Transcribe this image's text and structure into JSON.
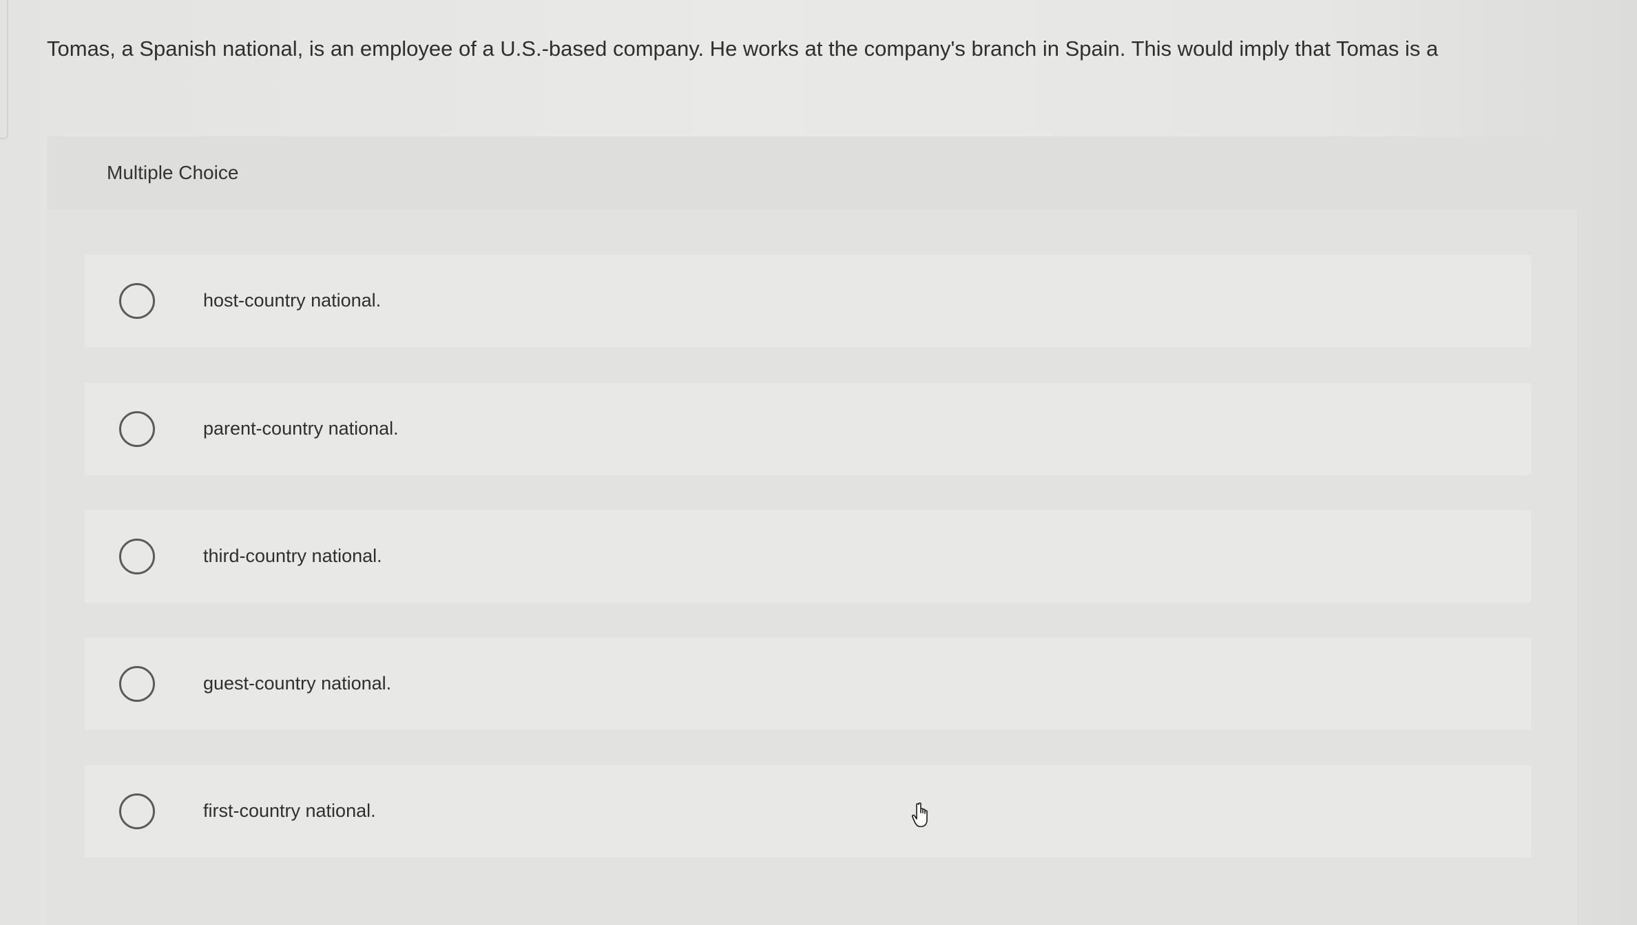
{
  "question": {
    "text": "Tomas, a Spanish national, is an employee of a U.S.-based company. He works at the company's branch in Spain. This would imply that Tomas is a"
  },
  "panel": {
    "header": "Multiple Choice"
  },
  "options": [
    {
      "label": "host-country national."
    },
    {
      "label": "parent-country national."
    },
    {
      "label": "third-country national."
    },
    {
      "label": "guest-country national."
    },
    {
      "label": "first-country national."
    }
  ],
  "icons": {
    "radio": "radio-unchecked-icon",
    "cursor": "hand-pointer-icon"
  }
}
